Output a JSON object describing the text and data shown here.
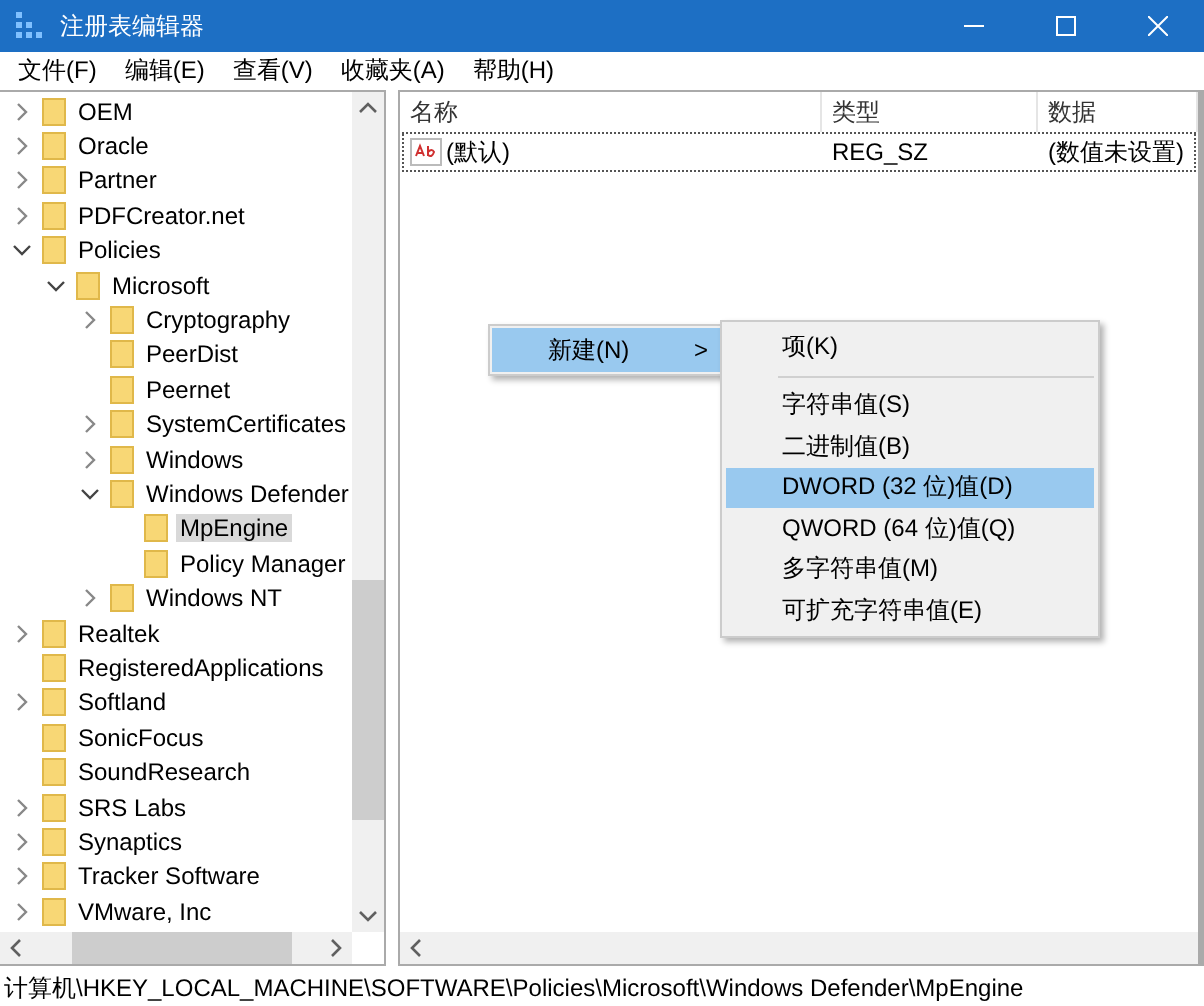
{
  "window": {
    "title": "注册表编辑器"
  },
  "menu_bar": [
    "文件(F)",
    "编辑(E)",
    "查看(V)",
    "收藏夹(A)",
    "帮助(H)"
  ],
  "tree": [
    {
      "label": "OEM",
      "kind": "collapsed",
      "selected": false
    },
    {
      "label": "Oracle",
      "kind": "collapsed",
      "selected": false
    },
    {
      "label": "Partner",
      "kind": "collapsed",
      "selected": false
    },
    {
      "label": "PDFCreator.net",
      "kind": "collapsed",
      "selected": false
    },
    {
      "label": "Policies",
      "kind": "expanded",
      "selected": false,
      "children": [
        {
          "label": "Microsoft",
          "kind": "expanded",
          "selected": false,
          "children": [
            {
              "label": "Cryptography",
              "kind": "collapsed",
              "selected": false
            },
            {
              "label": "PeerDist",
              "kind": "leaf",
              "selected": false
            },
            {
              "label": "Peernet",
              "kind": "leaf",
              "selected": false
            },
            {
              "label": "SystemCertificates",
              "kind": "collapsed",
              "selected": false
            },
            {
              "label": "Windows",
              "kind": "collapsed",
              "selected": false
            },
            {
              "label": "Windows Defender",
              "kind": "expanded",
              "selected": false,
              "children": [
                {
                  "label": "MpEngine",
                  "kind": "leaf",
                  "selected": true
                },
                {
                  "label": "Policy Manager",
                  "kind": "leaf",
                  "selected": false
                }
              ]
            },
            {
              "label": "Windows NT",
              "kind": "collapsed",
              "selected": false
            }
          ]
        }
      ]
    },
    {
      "label": "Realtek",
      "kind": "collapsed",
      "selected": false
    },
    {
      "label": "RegisteredApplications",
      "kind": "leaf",
      "selected": false
    },
    {
      "label": "Softland",
      "kind": "collapsed",
      "selected": false
    },
    {
      "label": "SonicFocus",
      "kind": "leaf",
      "selected": false
    },
    {
      "label": "SoundResearch",
      "kind": "leaf",
      "selected": false
    },
    {
      "label": "SRS Labs",
      "kind": "collapsed",
      "selected": false
    },
    {
      "label": "Synaptics",
      "kind": "collapsed",
      "selected": false
    },
    {
      "label": "Tracker Software",
      "kind": "collapsed",
      "selected": false
    },
    {
      "label": "VMware, Inc",
      "kind": "collapsed",
      "selected": false
    }
  ],
  "table": {
    "columns": [
      "名称",
      "类型",
      "数据"
    ],
    "rows": [
      {
        "name": "(默认)",
        "type": "REG_SZ",
        "data": "(数值未设置)"
      }
    ]
  },
  "context_menu": {
    "items": [
      {
        "label": "新建(N)",
        "arrow": ">",
        "selected": true
      }
    ]
  },
  "submenu": {
    "items": [
      {
        "kind": "item",
        "label": "项(K)",
        "selected": false
      },
      {
        "kind": "separator"
      },
      {
        "kind": "item",
        "label": "字符串值(S)",
        "selected": false
      },
      {
        "kind": "item",
        "label": "二进制值(B)",
        "selected": false
      },
      {
        "kind": "item",
        "label": "DWORD (32 位)值(D)",
        "selected": true
      },
      {
        "kind": "item",
        "label": "QWORD (64 位)值(Q)",
        "selected": false
      },
      {
        "kind": "item",
        "label": "多字符串值(M)",
        "selected": false
      },
      {
        "kind": "item",
        "label": "可扩充字符串值(E)",
        "selected": false
      }
    ]
  },
  "status_bar": "计算机\\HKEY_LOCAL_MACHINE\\SOFTWARE\\Policies\\Microsoft\\Windows Defender\\MpEngine"
}
